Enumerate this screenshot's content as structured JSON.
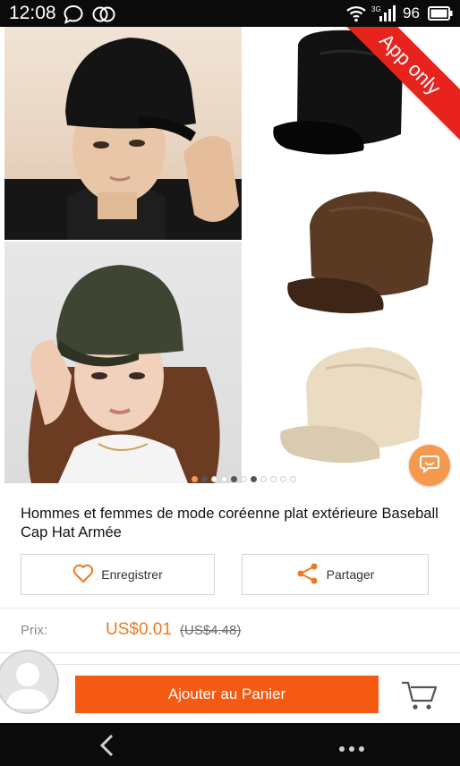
{
  "status": {
    "time": "12:08",
    "network": "3G",
    "battery": "96"
  },
  "gallery": {
    "badge": "App only",
    "dot_count": 11,
    "active_dot": 0
  },
  "product": {
    "title": "Hommes et femmes de mode coréenne plat extérieure Baseball Cap Hat Armée"
  },
  "actions": {
    "save_label": "Enregistrer",
    "share_label": "Partager"
  },
  "price": {
    "label": "Prix:",
    "current": "US$0.01",
    "original": "(US$4.48)"
  },
  "cart": {
    "add_label": "Ajouter au Panier"
  },
  "colors": {
    "accent": "#f45a12",
    "price": "#f07822",
    "badge": "#e8231d"
  }
}
